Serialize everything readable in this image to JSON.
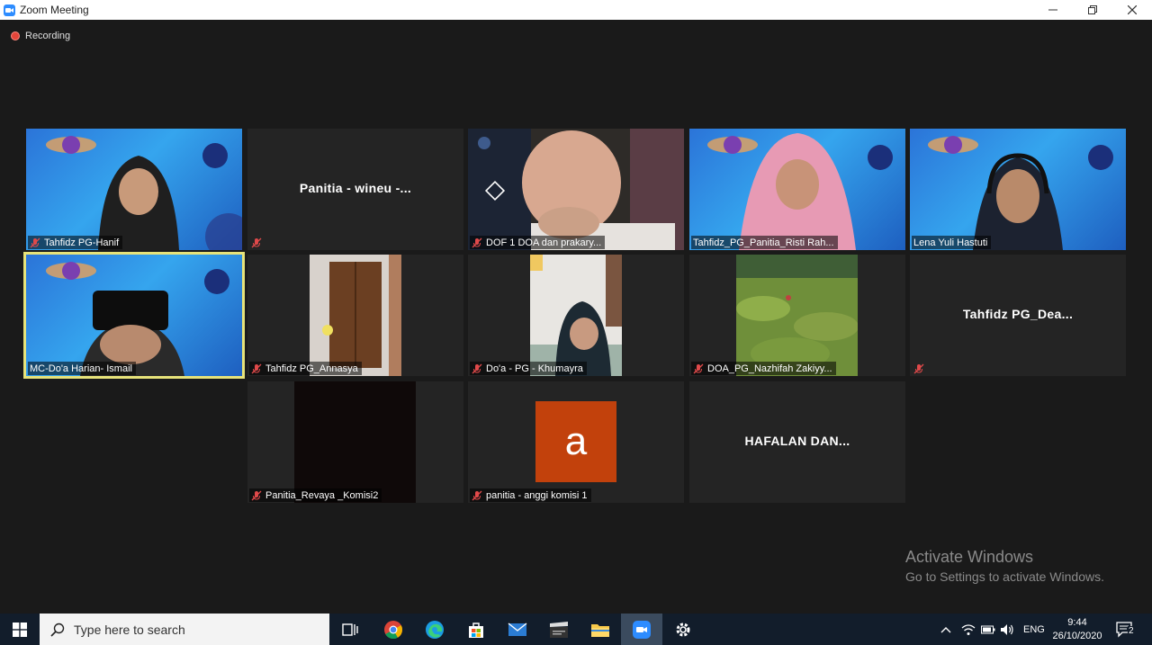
{
  "window": {
    "title": "Zoom Meeting"
  },
  "recording": {
    "label": "Recording"
  },
  "participants": [
    {
      "name": "Tahfidz PG-Hanif",
      "display": "",
      "video": "space"
    },
    {
      "name": "",
      "display": "Panitia - wineu -...",
      "video": "none"
    },
    {
      "name": "DOF 1 DOA dan prakary...",
      "display": "",
      "video": "child"
    },
    {
      "name": "Tahfidz_PG_Panitia_Risti Rah...",
      "display": "",
      "video": "space"
    },
    {
      "name": "Lena Yuli Hastuti",
      "display": "",
      "video": "space"
    },
    {
      "name": "MC-Do'a Harian- Ismail",
      "display": "",
      "video": "space"
    },
    {
      "name": "Tahfidz PG_Annasya",
      "display": "",
      "video": "room"
    },
    {
      "name": "Do'a - PG - Khumayra",
      "display": "",
      "video": "room"
    },
    {
      "name": "DOA_PG_Nazhifah Zakiyy...",
      "display": "",
      "video": "field"
    },
    {
      "name": "",
      "display": "Tahfidz PG_Dea...",
      "video": "none"
    },
    {
      "name": "Panitia_Revaya _Komisi2",
      "display": "",
      "video": "dark"
    },
    {
      "name": "panitia - anggi komisi 1",
      "display": "",
      "video": "avatar",
      "avatar_letter": "a",
      "avatar_color": "#c2410c"
    },
    {
      "name": "",
      "display": "HAFALAN DAN...",
      "video": "none"
    }
  ],
  "watermark": {
    "line1": "Activate Windows",
    "line2": "Go to Settings to activate Windows."
  },
  "taskbar": {
    "search_placeholder": "Type here to search",
    "language": "ENG",
    "time": "9:44",
    "date": "26/10/2020",
    "notification_count": "2"
  },
  "colors": {
    "active_speaker": "#e7e37a",
    "tile_bg": "#242424",
    "stage_bg": "#1a1a1a"
  }
}
